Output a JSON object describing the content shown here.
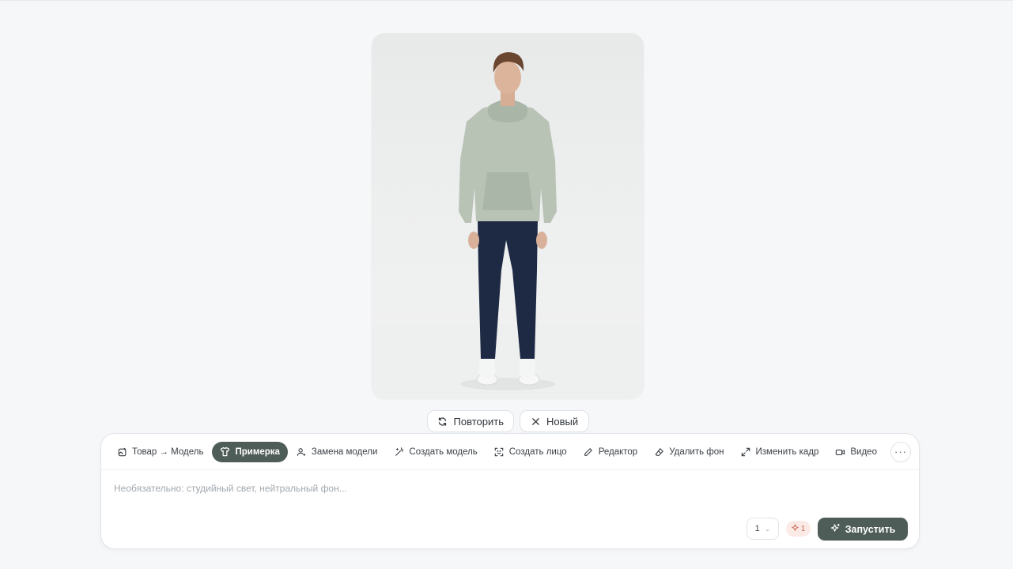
{
  "preview": {
    "image_alt": "model-in-hoodie-photo"
  },
  "actions": {
    "retry_label": "Повторить",
    "new_label": "Новый"
  },
  "toolbar": {
    "tools": [
      {
        "label": "Товар → Модель",
        "icon": "image-plus-icon"
      },
      {
        "label": "Примерка",
        "icon": "shirt-icon",
        "active": true
      },
      {
        "label": "Замена модели",
        "icon": "user-swap-icon"
      },
      {
        "label": "Создать модель",
        "icon": "magic-wand-icon"
      },
      {
        "label": "Создать лицо",
        "icon": "face-scan-icon"
      },
      {
        "label": "Редактор",
        "icon": "pencil-icon"
      },
      {
        "label": "Удалить фон",
        "icon": "eraser-icon"
      },
      {
        "label": "Изменить кадр",
        "icon": "expand-icon"
      },
      {
        "label": "Видео",
        "icon": "video-icon"
      }
    ],
    "more_label": "···"
  },
  "composer": {
    "prompt_placeholder": "Необязательно: студийный свет, нейтральный фон...",
    "prompt_value": "",
    "count_value": "1",
    "credits": "1",
    "run_label": "Запустить"
  },
  "colors": {
    "accent": "#4f5d58",
    "background": "#f6f7f9",
    "credit_bg": "#fbeae6",
    "credit_fg": "#d0705d"
  }
}
